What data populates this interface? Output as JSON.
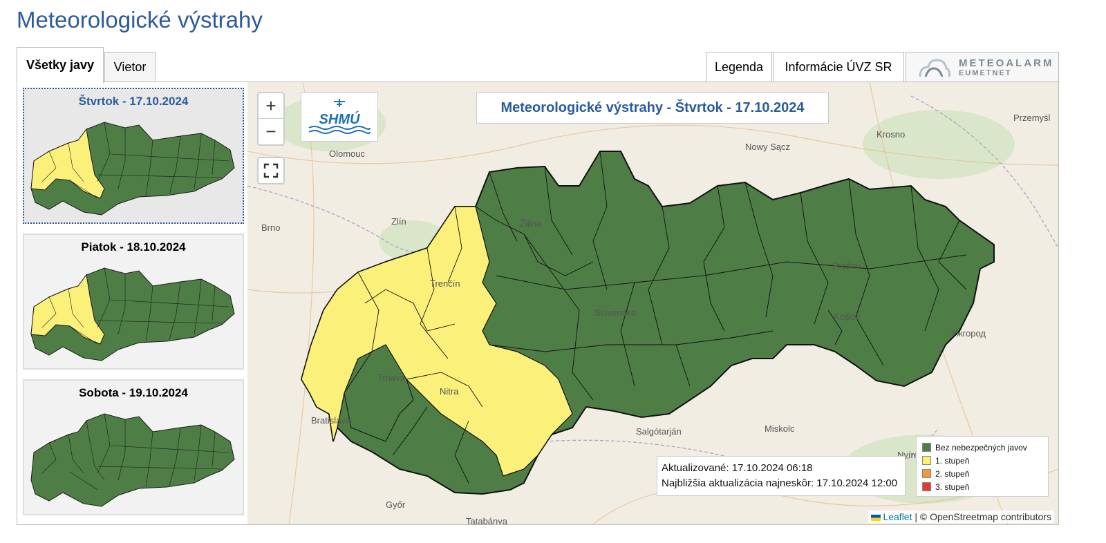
{
  "page_title": "Meteorologické výstrahy",
  "tabs": [
    {
      "label": "Všetky javy"
    },
    {
      "label": "Vietor"
    }
  ],
  "right_tabs": {
    "legenda": "Legenda",
    "info": "Informácie ÚVZ SR"
  },
  "meteoalarm": {
    "line1": "METEOALARM",
    "line2": "EUMETNET"
  },
  "days": [
    {
      "label": "Štvrtok - 17.10.2024"
    },
    {
      "label": "Piatok - 18.10.2024"
    },
    {
      "label": "Sobota - 19.10.2024"
    }
  ],
  "map": {
    "title": "Meteorologické výstrahy - Štvrtok - 17.10.2024",
    "zoom_in": "+",
    "zoom_out": "−",
    "logo_text": "SHMÚ",
    "updated": "Aktualizované: 17.10.2024 06:18",
    "next_update": "Najbližšia aktualizácia najneskôr: 17.10.2024 12:00",
    "cities": [
      "Olomouc",
      "Zlín",
      "Brno",
      "Žilina",
      "Trenčín",
      "Trnava",
      "Nitra",
      "Bratislava",
      "Slovensko",
      "Prešov",
      "Košice",
      "Nowy Sącz",
      "Krosno",
      "Przemyśl",
      "Salgótarján",
      "Miskolc",
      "Győr",
      "Tatabánya",
      "Nyíregyháza",
      "Ужгород"
    ],
    "attribution_leaflet": "Leaflet",
    "attribution_osm": "| © OpenStreetmap contributors"
  },
  "legend": [
    {
      "label": "Bez nebezpečných javov",
      "color": "#4e7d46"
    },
    {
      "label": "1. stupeň",
      "color": "#fef266"
    },
    {
      "label": "2. stupeň",
      "color": "#f59a3a"
    },
    {
      "label": "3. stupeň",
      "color": "#e53a2d"
    }
  ],
  "colors": {
    "green": "#4e7d46",
    "yellow": "#fbf07a",
    "title_blue": "#2b5b9c"
  }
}
